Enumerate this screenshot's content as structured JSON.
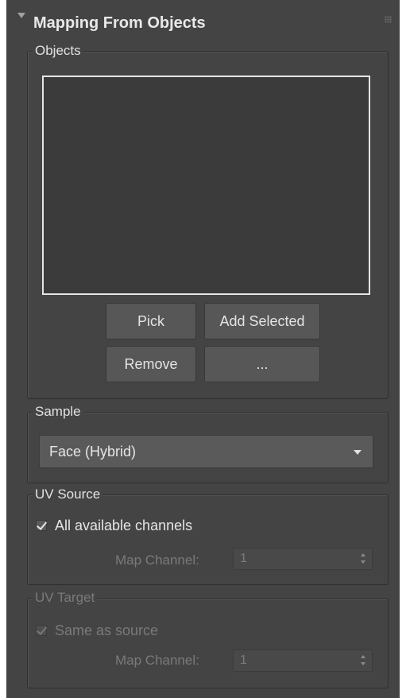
{
  "rollout": {
    "title": "Mapping From Objects"
  },
  "objects": {
    "label": "Objects",
    "pick_label": "Pick",
    "add_selected_label": "Add Selected",
    "remove_label": "Remove",
    "more_label": "..."
  },
  "sample": {
    "label": "Sample",
    "selected": "Face (Hybrid)"
  },
  "uv_source": {
    "label": "UV Source",
    "all_channels_label": "All available channels",
    "all_channels_checked": true,
    "map_channel_label": "Map Channel:",
    "map_channel_value": "1"
  },
  "uv_target": {
    "label": "UV Target",
    "same_as_source_label": "Same as source",
    "same_as_source_checked": true,
    "map_channel_label": "Map Channel:",
    "map_channel_value": "1"
  }
}
